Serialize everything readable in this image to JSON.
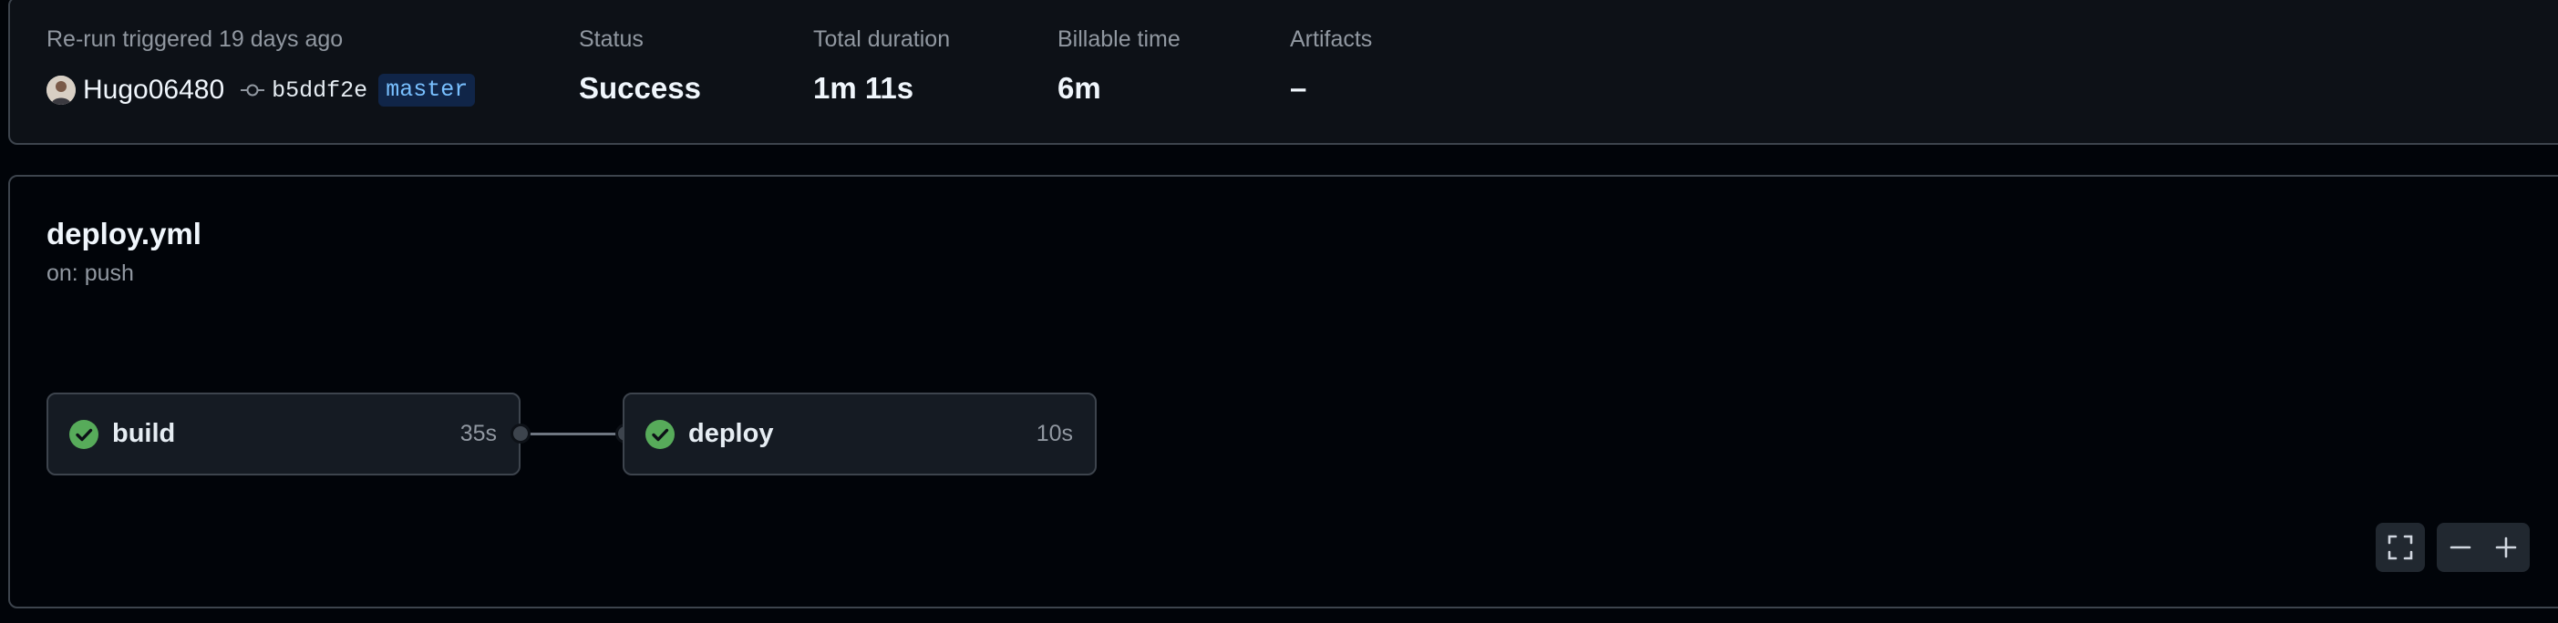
{
  "summary": {
    "trigger_label": "Re-run triggered 19 days ago",
    "actor": "Hugo06480",
    "commit_sha": "b5ddf2e",
    "branch": "master",
    "status_label": "Status",
    "status_value": "Success",
    "duration_label": "Total duration",
    "duration_value": "1m 11s",
    "billable_label": "Billable time",
    "billable_value": "6m",
    "artifacts_label": "Artifacts",
    "artifacts_value": "–"
  },
  "workflow": {
    "file": "deploy.yml",
    "trigger": "on: push",
    "jobs": [
      {
        "name": "build",
        "duration": "35s",
        "status": "success"
      },
      {
        "name": "deploy",
        "duration": "10s",
        "status": "success"
      }
    ]
  },
  "colors": {
    "success": "#57ab5a",
    "branch_text": "#79c0ff",
    "branch_bg": "#102548"
  },
  "icons": {
    "commit": "git-commit-icon",
    "check": "check-circle-icon",
    "fullscreen": "fullscreen-icon",
    "zoom_out": "minus-icon",
    "zoom_in": "plus-icon"
  }
}
